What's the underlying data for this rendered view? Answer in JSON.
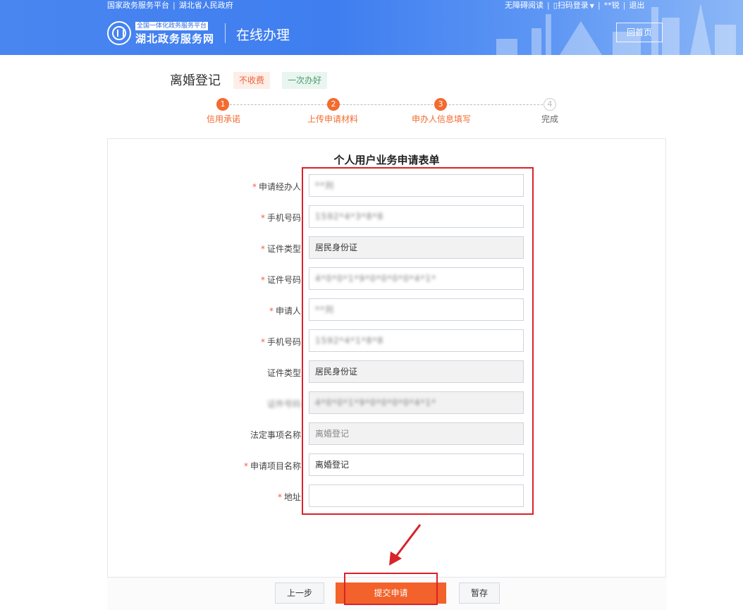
{
  "topbar": {
    "left_links": [
      "国家政务服务平台",
      "湖北省人民政府"
    ],
    "right_links": [
      "无障碍阅读",
      "扫码登录",
      "**锐",
      "退出"
    ]
  },
  "brand": {
    "small": "全国一体化政务服务平台",
    "name": "湖北政务服务网",
    "section": "在线办理"
  },
  "home_button": "回首页",
  "item": {
    "title": "离婚登记",
    "tags": [
      "不收费",
      "一次办好"
    ]
  },
  "steps": [
    {
      "num": "1",
      "label": "信用承诺",
      "state": "done"
    },
    {
      "num": "2",
      "label": "上传申请材料",
      "state": "done"
    },
    {
      "num": "3",
      "label": "申办人信息填写",
      "state": "current"
    },
    {
      "num": "4",
      "label": "完成",
      "state": "pending"
    }
  ],
  "form": {
    "title": "个人用户业务申请表单",
    "fields": [
      {
        "label": "申请经办人",
        "required": true,
        "value": "**刘",
        "blurred": true,
        "disabled": false
      },
      {
        "label": "手机号码",
        "required": true,
        "value": "1592*4*3*8*8",
        "blurred": true,
        "disabled": false
      },
      {
        "label": "证件类型",
        "required": true,
        "value": "居民身份证",
        "blurred": false,
        "disabled": true
      },
      {
        "label": "证件号码",
        "required": true,
        "value": "4*0*0*1*9*0*0*0*0*4*1*",
        "blurred": true,
        "disabled": false
      },
      {
        "label": "申请人",
        "required": true,
        "value": "**刘",
        "blurred": true,
        "disabled": false
      },
      {
        "label": "手机号码",
        "required": true,
        "value": "1592*4*1*8*8",
        "blurred": true,
        "disabled": false
      },
      {
        "label": "证件类型",
        "required": false,
        "value": "居民身份证",
        "blurred": false,
        "disabled": true
      },
      {
        "label": "证件号码",
        "required": false,
        "value": "4*0*0*1*9*0*0*0*0*4*1*",
        "blurred": true,
        "disabled": true
      },
      {
        "label": "法定事项名称",
        "required": false,
        "value": "离婚登记",
        "blurred": false,
        "disabled": true
      },
      {
        "label": "申请项目名称",
        "required": true,
        "value": "离婚登记",
        "blurred": false,
        "disabled": false
      },
      {
        "label": "地址",
        "required": true,
        "value": "",
        "blurred": false,
        "disabled": false
      }
    ]
  },
  "buttons": {
    "prev": "上一步",
    "submit": "提交申请",
    "save": "暂存"
  },
  "colors": {
    "header_blue": "#4a86f0",
    "accent_orange": "#f26b2f",
    "highlight_red": "#d9222a"
  }
}
